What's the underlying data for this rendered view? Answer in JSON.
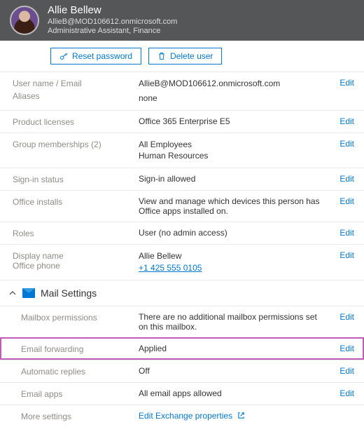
{
  "header": {
    "name": "Allie Bellew",
    "email": "AllieB@MOD106612.onmicrosoft.com",
    "role": "Administrative Assistant, Finance"
  },
  "buttons": {
    "reset": "Reset password",
    "delete": "Delete user"
  },
  "rows": {
    "username": {
      "label": "User name / Email",
      "value": "AllieB@MOD106612.onmicrosoft.com"
    },
    "aliases": {
      "label": "Aliases",
      "value": "none"
    },
    "licenses": {
      "label": "Product licenses",
      "value": "Office 365 Enterprise E5"
    },
    "groups": {
      "label": "Group memberships (2)",
      "value1": "All Employees",
      "value2": "Human Resources"
    },
    "signin": {
      "label": "Sign-in status",
      "value": "Sign-in allowed"
    },
    "installs": {
      "label": "Office installs",
      "value": "View and manage which devices this person has Office apps installed on."
    },
    "userrole": {
      "label": "Roles",
      "value": "User (no admin access)"
    },
    "display": {
      "label1": "Display name",
      "label2": "Office phone",
      "name": "Allie Bellew",
      "phone": "+1 425 555 0105"
    }
  },
  "mail": {
    "heading": "Mail Settings",
    "perm": {
      "label": "Mailbox permissions",
      "value": "There are no additional mailbox permissions set on this mailbox."
    },
    "forward": {
      "label": "Email forwarding",
      "value": "Applied"
    },
    "auto": {
      "label": "Automatic replies",
      "value": "Off"
    },
    "apps": {
      "label": "Email apps",
      "value": "All email apps allowed"
    },
    "more": {
      "label": "More settings",
      "value": "Edit Exchange properties"
    }
  },
  "edit_label": "Edit"
}
